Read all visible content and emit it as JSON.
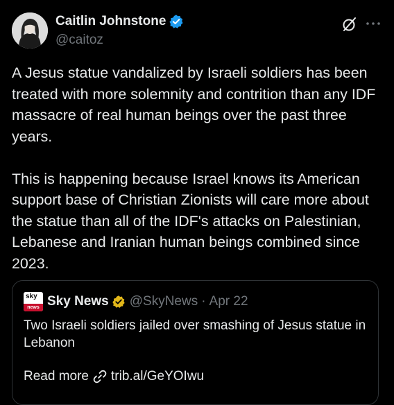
{
  "author": {
    "name": "Caitlin Johnstone",
    "handle": "@caitoz",
    "verified": true
  },
  "tweet": {
    "text": "A Jesus statue vandalized by Israeli soldiers has been treated with more solemnity and contrition than any IDF massacre of real human beings over the past three years.\n\nThis is happening because Israel knows its American support base of Christian Zionists will care more about the statue than all of the IDF's attacks on Palestinian, Lebanese and Iranian human beings combined since 2023."
  },
  "quote": {
    "logo": {
      "top": "sky",
      "bottom": "news"
    },
    "name": "Sky News",
    "handle": "@SkyNews",
    "separator": "·",
    "date": "Apr 22",
    "text": "Two Israeli soldiers jailed over smashing of Jesus statue in Lebanon",
    "read_more": "Read more",
    "link": "trib.al/GeYOIwu"
  },
  "icons": {
    "verified": "verified-badge-icon",
    "gold_verified": "gold-verified-badge-icon",
    "grok": "grok-icon",
    "more": "more-icon",
    "link": "link-icon"
  },
  "colors": {
    "background": "#000000",
    "text": "#e7e9ea",
    "secondary": "#71767b",
    "verified_blue": "#1d9bf0",
    "gold": "#e2b719",
    "border": "#2f3336",
    "sky_red": "#c8102e"
  }
}
